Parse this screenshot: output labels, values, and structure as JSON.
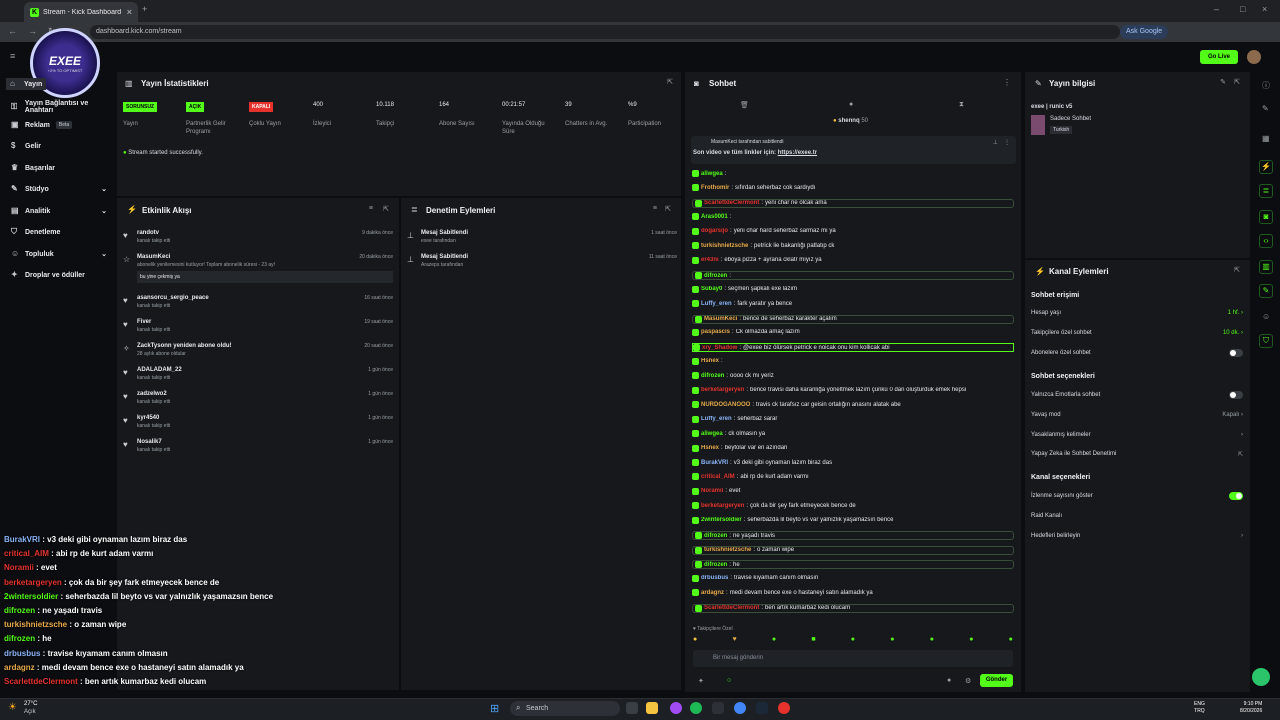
{
  "browser": {
    "tab_title": "Stream - Kick Dashboard",
    "url": "dashboard.kick.com/stream",
    "ask_google": "Ask Google"
  },
  "header": {
    "go_live": "Go Live"
  },
  "logo": {
    "title": "EXEE",
    "subtitle": "+2% TO OPTIMIST"
  },
  "sidebar": {
    "items": [
      {
        "label": "Yayın"
      },
      {
        "label": "Yayın Bağlantısı ve Anahtarı"
      },
      {
        "label": "Reklam",
        "badge": "Beta"
      },
      {
        "label": "Gelir"
      },
      {
        "label": "Başarılar"
      },
      {
        "label": "Stüdyo"
      },
      {
        "label": "Analitik"
      },
      {
        "label": "Denetleme"
      },
      {
        "label": "Topluluk"
      },
      {
        "label": "Droplar ve ödüller"
      }
    ]
  },
  "stats": {
    "title": "Yayın İstatistikleri",
    "success": "Stream started successfully.",
    "items": [
      {
        "value": "SORUNSUZ",
        "label": "Yayın",
        "color": "#53fc18"
      },
      {
        "value": "AÇIK",
        "label": "Partnerlik Gelir Programı",
        "color": "#53fc18"
      },
      {
        "value": "KAPALI",
        "label": "Çoklu Yayın",
        "color": "#e5322d"
      },
      {
        "value": "400",
        "label": "İzleyici"
      },
      {
        "value": "10.118",
        "label": "Takipçi"
      },
      {
        "value": "164",
        "label": "Abone Sayısı"
      },
      {
        "value": "00:21:57",
        "label": "Yayında Olduğu Süre"
      },
      {
        "value": "39",
        "label": "Chatters in Avg."
      },
      {
        "value": "%9",
        "label": "Participation"
      }
    ]
  },
  "activity": {
    "title": "Etkinlik Akışı",
    "items": [
      {
        "name": "randotv",
        "desc": "kanalı takip etti",
        "time": "9 dakika önce"
      },
      {
        "name": "MasumKeci",
        "desc": "abonelik yenilemesini kutluyor! Toplam abonelik süresi - 23 ay!",
        "note": "bu yine çekmiş ya",
        "time": "20 dakika önce"
      },
      {
        "name": "asansorcu_sergio_peace",
        "desc": "kanalı takip etti",
        "time": "16 saat önce"
      },
      {
        "name": "Fiver",
        "desc": "kanalı takip etti",
        "time": "19 saat önce"
      },
      {
        "name": "ZackTysonn yeniden abone oldu!",
        "desc": "28 aylık abone oldular",
        "time": "20 saat önce"
      },
      {
        "name": "ADALADAM_22",
        "desc": "kanalı takip etti",
        "time": "1 gün önce"
      },
      {
        "name": "zadzelwo2",
        "desc": "kanalı takip etti",
        "time": "1 gün önce"
      },
      {
        "name": "kyr4540",
        "desc": "kanalı takip etti",
        "time": "1 gün önce"
      },
      {
        "name": "Nosalik7",
        "desc": "kanalı takip etti",
        "time": "1 gün önce"
      }
    ]
  },
  "audit": {
    "title": "Denetim Eylemleri",
    "items": [
      {
        "name": "Mesaj Sabitlendi",
        "desc": "exee tarafından",
        "time": "1 saat önce"
      },
      {
        "name": "Mesaj Sabitlendi",
        "desc": "Arazeps tarafından",
        "time": "11 saat önce"
      }
    ]
  },
  "chat": {
    "title": "Sohbet",
    "top_user": "shennq",
    "top_count": "50",
    "pinned_by": "MasumKeci tarafından sabitlendi",
    "pinned_text": "Son video ve tüm linkler için:",
    "pinned_link": "https://exee.tr",
    "input_placeholder": "Bir mesaj gönderin",
    "send": "Gönder",
    "followers_only": "Takipçilere Özel",
    "messages": [
      {
        "user": "aliwgea",
        "text": "",
        "color": "#53fc18"
      },
      {
        "user": "Frothomir",
        "text": "sıfırdan seherbaz cok sardıydı",
        "color": "#e8a94a"
      },
      {
        "user": "ScarlettdeClermont",
        "text": "yeni char ne olcak ama",
        "color": "#e5322d",
        "hl": true
      },
      {
        "user": "Aras0001",
        "text": "",
        "color": "#53fc18"
      },
      {
        "user": "dogarsijo",
        "text": "yeni char hard seherbaz sarmaz mı ya",
        "color": "#e5322d"
      },
      {
        "user": "turkishnietzsche",
        "text": "petrick lie bakanlığı patlatıp ck",
        "color": "#e8a94a"
      },
      {
        "user": "er43nı",
        "text": "eboya pizza + ayrana cklatr mıyız ya",
        "color": "#e5322d"
      },
      {
        "user": "difrozen",
        "text": "",
        "color": "#53fc18",
        "hl": true
      },
      {
        "user": "Subay0",
        "text": "seçmen şapkalı exe lazım",
        "color": "#53fc18"
      },
      {
        "user": "Luffy_eren",
        "text": "fark yaratır ya bence",
        "color": "#8ab4f8"
      },
      {
        "user": "MasumKeci",
        "text": "bence de seherbaz karakter açalım",
        "color": "#e8a94a",
        "hl": true
      },
      {
        "user": "paspascis",
        "text": "Ck olmazda amaç lazım",
        "color": "#e8a94a"
      },
      {
        "user": "xry_Shadow",
        "text": "@exee biz ölürsek petrick e noicak onu kim kollicak abi",
        "color": "#e5322d",
        "green": true
      },
      {
        "user": "Hsnex",
        "text": "",
        "color": "#e8a94a"
      },
      {
        "user": "difrozen",
        "text": "oooo ck mı yeriz",
        "color": "#53fc18"
      },
      {
        "user": "berketargeryen",
        "text": "bence travisi daha karanlığa yöneltmek lazım çünkü 0 dan oluşturduk emek hepsi",
        "color": "#e5322d"
      },
      {
        "user": "NURDOGANOOO",
        "text": "travis ck tarafsız car geisin ortalığın anasını alatak abe",
        "color": "#e8a94a"
      },
      {
        "user": "Luffy_eren",
        "text": "seherbaz sarar",
        "color": "#8ab4f8"
      },
      {
        "user": "aliwgea",
        "text": "ck olmasın ya",
        "color": "#53fc18"
      },
      {
        "user": "Hsnex",
        "text": "beytolar var en azından",
        "color": "#e8a94a"
      },
      {
        "user": "BurakVRI",
        "text": "v3 deki gibi oynaman lazım biraz das",
        "color": "#8ab4f8"
      },
      {
        "user": "critical_AIM",
        "text": "abi rp de kurt adam varmı",
        "color": "#e5322d"
      },
      {
        "user": "Noramii",
        "text": "evet",
        "color": "#e5322d"
      },
      {
        "user": "berketargeryen",
        "text": "çok da bir şey fark etmeyecek bence de",
        "color": "#e5322d"
      },
      {
        "user": "2wintersoldier",
        "text": "seherbazda lil beyto vs var yalnızlık yaşamazsın bence",
        "color": "#53fc18"
      },
      {
        "user": "difrozen",
        "text": "ne yaşadı travis",
        "color": "#53fc18",
        "hl": true
      },
      {
        "user": "turkishnietzsche",
        "text": "o zaman wipe",
        "color": "#e8a94a",
        "hl": true
      },
      {
        "user": "difrozen",
        "text": "he",
        "color": "#53fc18",
        "hl": true
      },
      {
        "user": "drbusbus",
        "text": "travise kıyamam canım olmasın",
        "color": "#8ab4f8"
      },
      {
        "user": "ardagnz",
        "text": "medi devam bence exe o hastaneyi satın alamadık ya",
        "color": "#e8a94a"
      },
      {
        "user": "ScarlettdeClermont",
        "text": "ben artık kumarbaz kedi olucam",
        "color": "#e5322d",
        "hl": true
      }
    ]
  },
  "info": {
    "title": "Yayın bilgisi",
    "stream_title": "exee | runic v5",
    "line1": "Sadece Sohbet",
    "line2": "Turkish"
  },
  "actions": {
    "title": "Kanal Eylemleri",
    "chat_access": "Sohbet erişimi",
    "slow_mode": "Hesap yaşı",
    "slow_value": "1 hf.",
    "follower_only": "Takipçilere özel sohbet",
    "follower_value": "10 dk.",
    "sub_only": "Abonelere özel sohbet",
    "chat_options": "Sohbet seçenekleri",
    "emote_only": "Yalnızca Emotlarla sohbet",
    "slow": "Yavaş mod",
    "slow_state": "Kapalı",
    "banned_words": "Yasaklanmış kelimeler",
    "ai_mod": "Yapay Zeka ile Sohbet Denetimi",
    "channel_options": "Kanal seçenekleri",
    "show_viewers": "İzlenme sayısını göster",
    "raid": "Raid Kanalı",
    "set_goals": "Hedefleri belirleyin"
  },
  "overlay": [
    {
      "user": "BurakVRI",
      "text": "v3 deki gibi oynaman lazım biraz das",
      "color": "#8ab4f8"
    },
    {
      "user": "critical_AIM",
      "text": "abi rp de kurt adam varmı",
      "color": "#e5322d"
    },
    {
      "user": "Noramii",
      "text": "evet",
      "color": "#e5322d"
    },
    {
      "user": "berketargeryen",
      "text": "çok da bir şey fark etmeyecek bence de",
      "color": "#e5322d"
    },
    {
      "user": "2wintersoldier",
      "text": "seherbazda lil beyto vs var yalnızlık yaşamazsın bence",
      "color": "#53fc18"
    },
    {
      "user": "difrozen",
      "text": "ne yaşadı travis",
      "color": "#53fc18"
    },
    {
      "user": "turkishnietzsche",
      "text": "o zaman wipe",
      "color": "#e8a94a"
    },
    {
      "user": "difrozen",
      "text": "he",
      "color": "#53fc18"
    },
    {
      "user": "drbusbus",
      "text": "travise kıyamam canım olmasın",
      "color": "#8ab4f8"
    },
    {
      "user": "ardagnz",
      "text": "medi devam bence exe o hastaneyi satın alamadık ya",
      "color": "#e8a94a"
    },
    {
      "user": "ScarlettdeClermont",
      "text": "ben artık kumarbaz kedi olucam",
      "color": "#e5322d"
    }
  ],
  "taskbar": {
    "weather": "27°C",
    "weather_desc": "Açık",
    "search": "Search",
    "lang": "ENG",
    "lang2": "TRQ",
    "time": "9:10 PM",
    "date": "8/20/2026"
  }
}
